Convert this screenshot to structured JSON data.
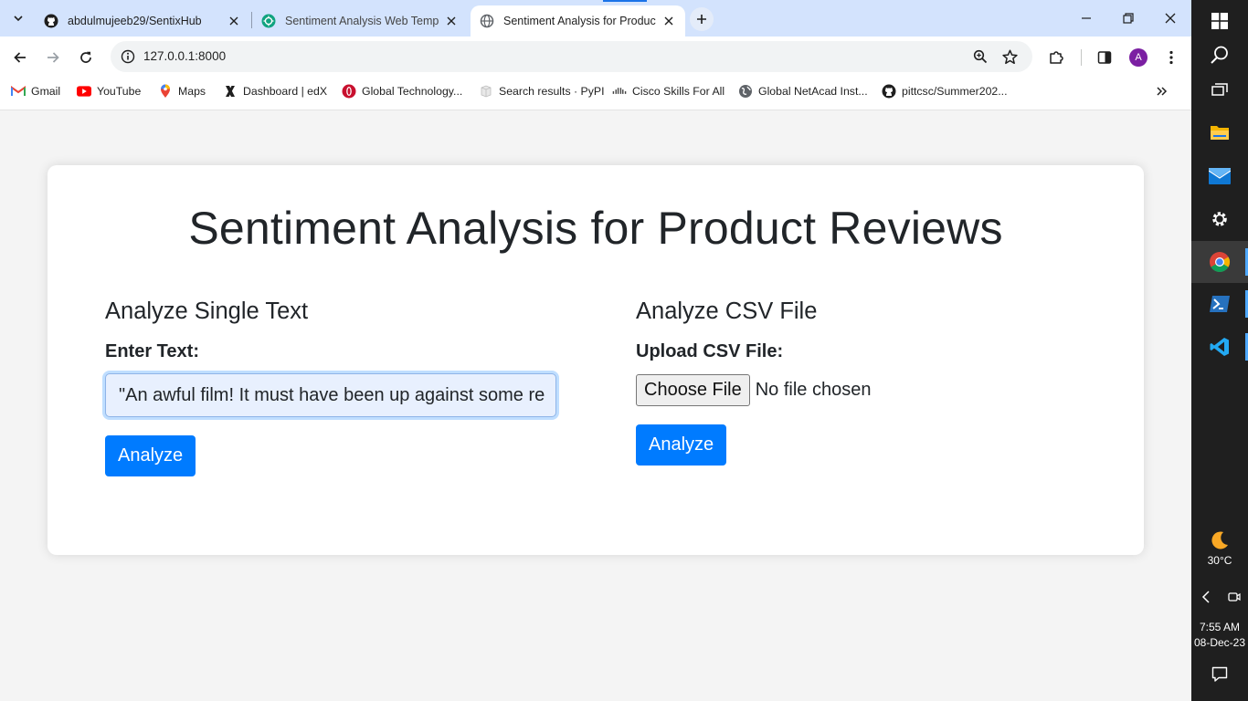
{
  "tabs": [
    {
      "title": "abdulmujeeb29/SentixHub",
      "icon": "github-icon",
      "active": false
    },
    {
      "title": "Sentiment Analysis Web Templa",
      "icon": "chatgpt-icon",
      "active": false
    },
    {
      "title": "Sentiment Analysis for Product",
      "icon": "globe-icon",
      "active": true
    }
  ],
  "address_bar": {
    "url": "127.0.0.1:8000"
  },
  "bookmarks": [
    {
      "label": "Gmail",
      "icon": "gmail-icon"
    },
    {
      "label": "YouTube",
      "icon": "youtube-icon"
    },
    {
      "label": "Maps",
      "icon": "maps-icon"
    },
    {
      "label": "Dashboard | edX",
      "icon": "edx-icon"
    },
    {
      "label": "Global Technology...",
      "icon": "opera-icon"
    },
    {
      "label": "Search results · PyPI",
      "icon": "pypi-icon"
    },
    {
      "label": "Cisco Skills For All",
      "icon": "cisco-icon"
    },
    {
      "label": "Global NetAcad Inst...",
      "icon": "globe-icon"
    },
    {
      "label": "pittcsc/Summer202...",
      "icon": "github-icon"
    }
  ],
  "profile": {
    "initial": "A",
    "color": "#7b1fa2"
  },
  "page": {
    "title": "Sentiment Analysis for Product Reviews",
    "single": {
      "heading": "Analyze Single Text",
      "label": "Enter Text:",
      "value": "\"An awful film! It must have been up against some re",
      "button": "Analyze"
    },
    "csv": {
      "heading": "Analyze CSV File",
      "label": "Upload CSV File:",
      "file_button": "Choose File",
      "file_status": "No file chosen",
      "button": "Analyze"
    }
  },
  "colors": {
    "primary": "#007bff",
    "page_bg": "#f4f4f4",
    "text": "#212529"
  },
  "taskbar": {
    "apps": [
      "windows-icon",
      "search-icon",
      "task-view-icon",
      "file-explorer-icon",
      "mail-icon",
      "settings-icon",
      "chrome-icon",
      "powershell-icon",
      "vscode-icon"
    ],
    "weather": {
      "temp": "30°C",
      "icon": "moon-icon"
    },
    "clock": {
      "time": "7:55 AM",
      "date": "08-Dec-23"
    }
  }
}
